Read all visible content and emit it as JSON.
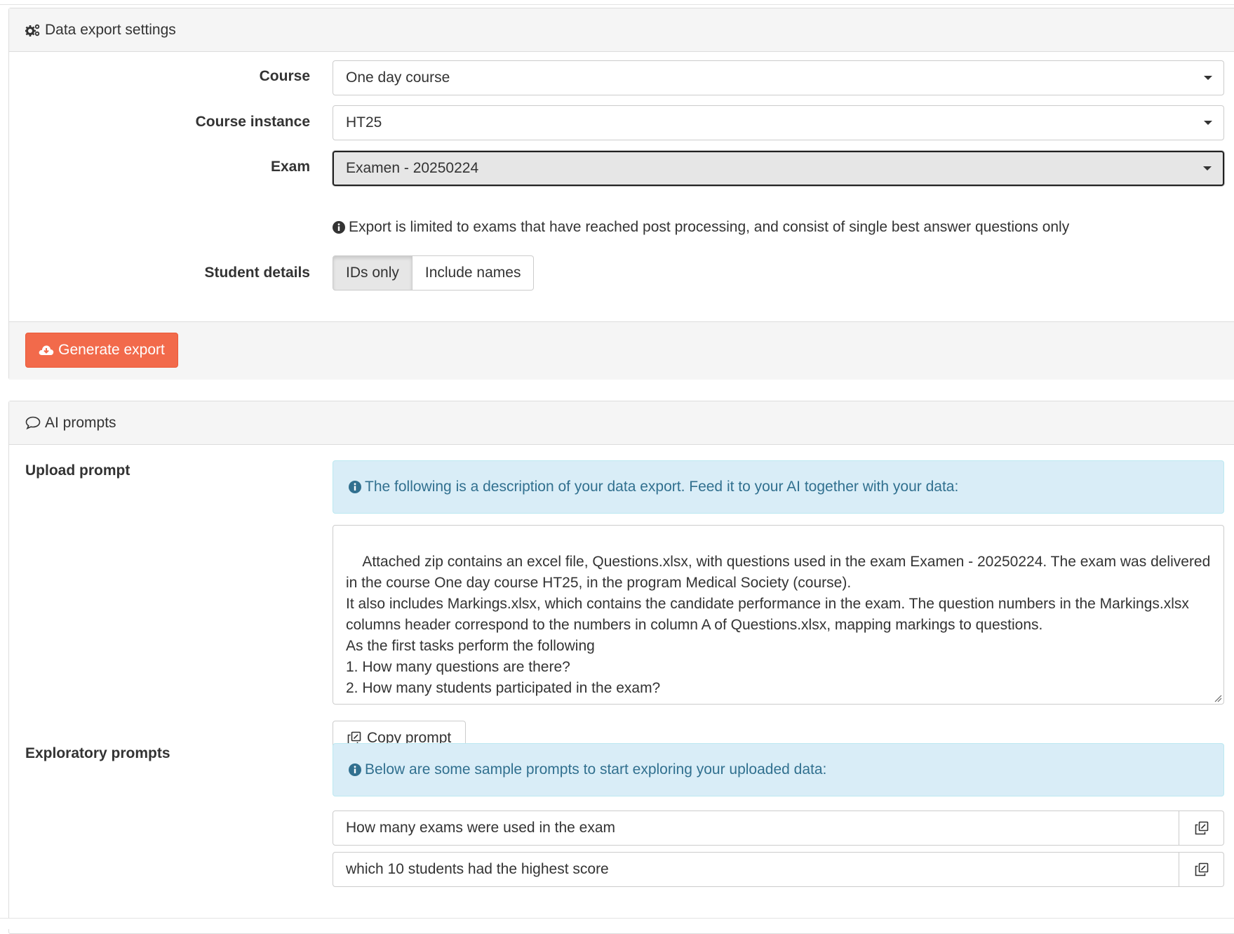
{
  "export_panel": {
    "title": "Data export settings",
    "course": {
      "label": "Course",
      "value": "One day course"
    },
    "course_instance": {
      "label": "Course instance",
      "value": "HT25"
    },
    "exam": {
      "label": "Exam",
      "value": "Examen - 20250224"
    },
    "help_text": "Export is limited to exams that have reached post processing, and consist of single best answer questions only",
    "student_details": {
      "label": "Student details",
      "options": [
        "IDs only",
        "Include names"
      ],
      "selected": "IDs only"
    },
    "generate_label": "Generate export",
    "accent_color": "#f26a4b"
  },
  "ai_panel": {
    "title": "AI prompts",
    "upload": {
      "label": "Upload prompt",
      "info": "The following is a description of your data export. Feed it to your AI together with your data:",
      "prompt_text": "Attached zip contains an excel file, Questions.xlsx, with questions used in the exam Examen - 20250224. The exam was delivered in the course One day course HT25, in the program Medical Society (course).\nIt also includes Markings.xlsx, which contains the candidate performance in the exam. The question numbers in the Markings.xlsx columns header correspond to the numbers in column A of Questions.xlsx, mapping markings to questions.\nAs the first tasks perform the following\n1. How many questions are there?\n2. How many students participated in the exam?",
      "copy_label": "Copy prompt"
    },
    "exploratory": {
      "label": "Exploratory prompts",
      "info": "Below are some sample prompts to start exploring your uploaded data:",
      "prompts": [
        "How many exams were used in the exam",
        "which 10 students had the highest score"
      ]
    },
    "info_color": "#31708f"
  }
}
